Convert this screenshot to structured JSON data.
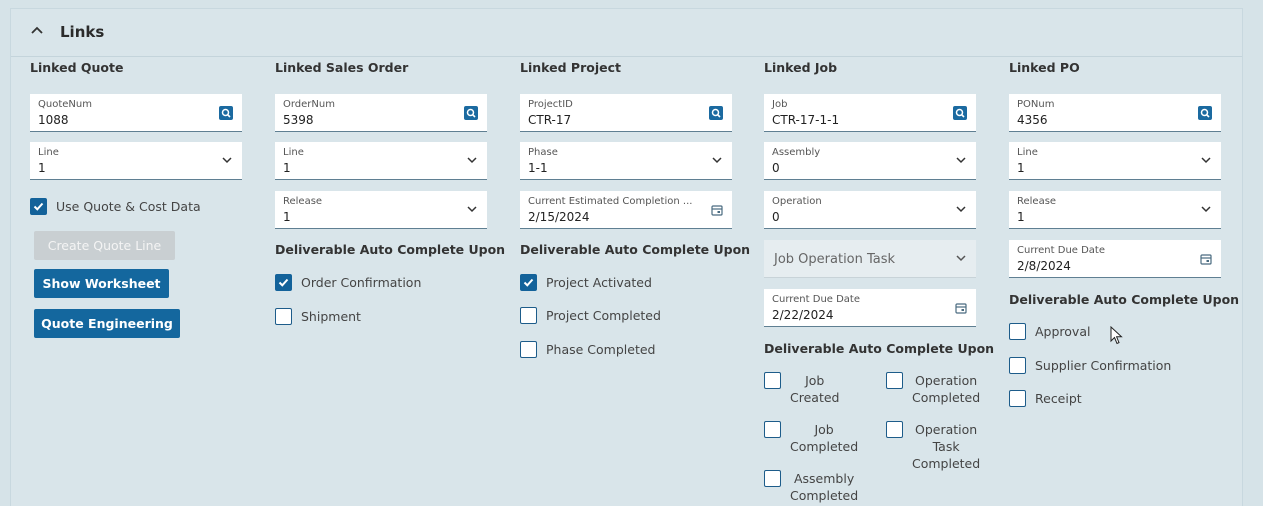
{
  "section": {
    "title": "Links"
  },
  "quote": {
    "title": "Linked Quote",
    "quotenum_label": "QuoteNum",
    "quotenum_value": "1088",
    "line_label": "Line",
    "line_value": "1",
    "use_cost_label": "Use Quote & Cost Data",
    "use_cost_checked": true,
    "create_line_btn": "Create Quote Line",
    "show_worksheet_btn": "Show Worksheet",
    "quote_engineering_btn": "Quote Engineering"
  },
  "sales_order": {
    "title": "Linked Sales Order",
    "ordernum_label": "OrderNum",
    "ordernum_value": "5398",
    "line_label": "Line",
    "line_value": "1",
    "release_label": "Release",
    "release_value": "1",
    "deliverable_label": "Deliverable Auto Complete Upon",
    "checks": [
      {
        "label": "Order Confirmation",
        "checked": true
      },
      {
        "label": "Shipment",
        "checked": false
      }
    ]
  },
  "project": {
    "title": "Linked Project",
    "projectid_label": "ProjectID",
    "projectid_value": "CTR-17",
    "phase_label": "Phase",
    "phase_value": "1-1",
    "completion_label": "Current Estimated Completion ...",
    "completion_value": "2/15/2024",
    "deliverable_label": "Deliverable Auto Complete Upon",
    "checks": [
      {
        "label": "Project Activated",
        "checked": true
      },
      {
        "label": "Project Completed",
        "checked": false
      },
      {
        "label": "Phase Completed",
        "checked": false
      }
    ]
  },
  "job": {
    "title": "Linked Job",
    "job_label": "Job",
    "job_value": "CTR-17-1-1",
    "assembly_label": "Assembly",
    "assembly_value": "0",
    "operation_label": "Operation",
    "operation_value": "0",
    "op_task_placeholder": "Job Operation Task",
    "due_label": "Current Due Date",
    "due_value": "2/22/2024",
    "deliverable_label": "Deliverable Auto Complete Upon",
    "checks": [
      {
        "line1": "Job",
        "line2": "Created",
        "line3": ""
      },
      {
        "line1": "Operation",
        "line2": "Completed",
        "line3": ""
      },
      {
        "line1": "Job",
        "line2": "Completed",
        "line3": ""
      },
      {
        "line1": "Operation",
        "line2": "Task",
        "line3": "Completed"
      },
      {
        "line1": "Assembly",
        "line2": "Completed",
        "line3": ""
      }
    ]
  },
  "po": {
    "title": "Linked PO",
    "ponum_label": "PONum",
    "ponum_value": "4356",
    "line_label": "Line",
    "line_value": "1",
    "release_label": "Release",
    "release_value": "1",
    "due_label": "Current Due Date",
    "due_value": "2/8/2024",
    "deliverable_label": "Deliverable Auto Complete Upon",
    "checks": [
      {
        "label": "Approval",
        "checked": false
      },
      {
        "label": "Supplier Confirmation",
        "checked": false
      },
      {
        "label": "Receipt",
        "checked": false
      }
    ]
  }
}
